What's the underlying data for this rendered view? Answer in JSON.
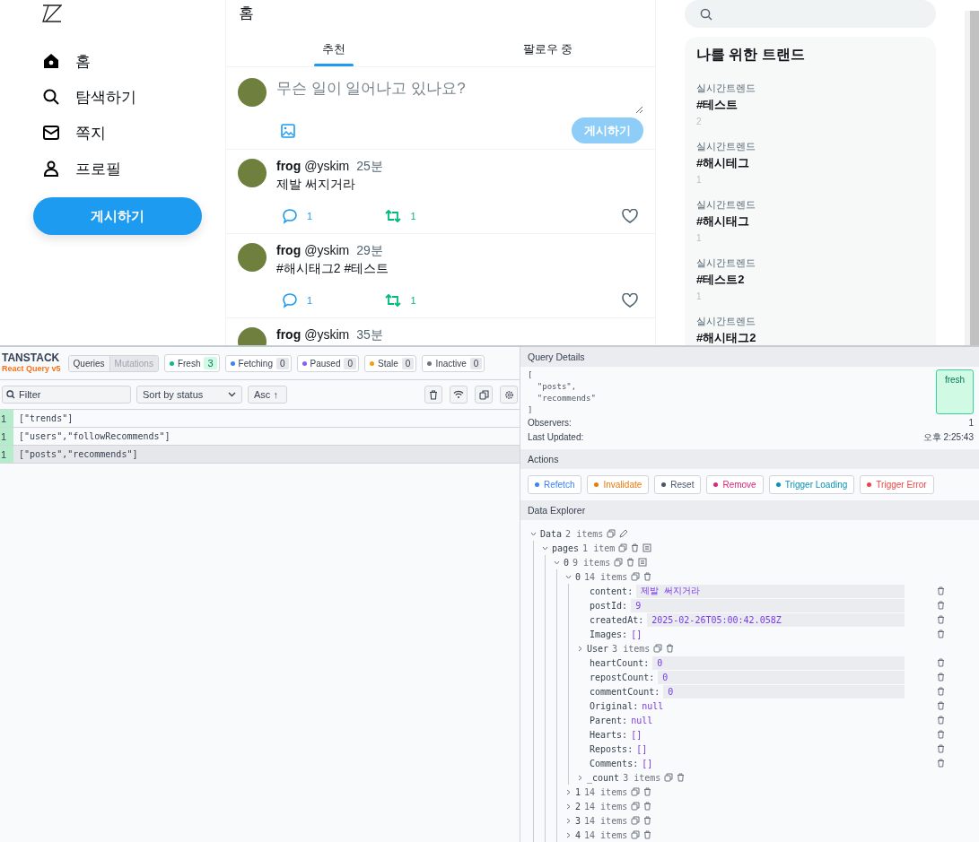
{
  "sidebar": {
    "nav": [
      {
        "label": "홈"
      },
      {
        "label": "탐색하기"
      },
      {
        "label": "쪽지"
      },
      {
        "label": "프로필"
      }
    ],
    "post_button": "게시하기"
  },
  "main": {
    "title": "홈",
    "tabs": [
      {
        "label": "추천",
        "selected": true
      },
      {
        "label": "팔로우 중",
        "selected": false
      }
    ],
    "compose": {
      "placeholder": "무슨 일이 일어나고 있나요?",
      "submit": "게시하기",
      "disabled": true
    },
    "posts": [
      {
        "author": "frog",
        "handle": "@yskim",
        "time": "25분",
        "content": "제발 써지거라",
        "comments": "1",
        "reposts": "1"
      },
      {
        "author": "frog",
        "handle": "@yskim",
        "time": "29분",
        "content": "#해시태그2 #테스트",
        "comments": "1",
        "reposts": "1"
      },
      {
        "author": "frog",
        "handle": "@yskim",
        "time": "35분"
      }
    ]
  },
  "trends": {
    "title": "나를 위한 트랜드",
    "items": [
      {
        "category": "실시간트렌드",
        "tag": "#테스트",
        "count": "2"
      },
      {
        "category": "실시간트렌드",
        "tag": "#해시테그",
        "count": "1"
      },
      {
        "category": "실시간트렌드",
        "tag": "#해시태그",
        "count": "1"
      },
      {
        "category": "실시간트렌드",
        "tag": "#테스트2",
        "count": "1"
      },
      {
        "category": "실시간트렌드",
        "tag": "#해시태그2"
      }
    ]
  },
  "devtools": {
    "brand": {
      "name": "TANSTACK",
      "product": "React Query v5"
    },
    "view_tabs": [
      {
        "label": "Queries",
        "selected": true
      },
      {
        "label": "Mutations",
        "selected": false
      }
    ],
    "statuses": [
      {
        "label": "Fresh",
        "count": "3",
        "color": "#10b981",
        "active": true
      },
      {
        "label": "Fetching",
        "count": "0",
        "color": "#3b82f6",
        "active": false
      },
      {
        "label": "Paused",
        "count": "0",
        "color": "#8b5cf6",
        "active": false
      },
      {
        "label": "Stale",
        "count": "0",
        "color": "#f59e0b",
        "active": false
      },
      {
        "label": "Inactive",
        "count": "0",
        "color": "#6b7280",
        "active": false
      }
    ],
    "filter": {
      "placeholder": "Filter"
    },
    "sort": {
      "value": "Sort by status"
    },
    "order": {
      "value": "Asc ↑"
    },
    "queries": [
      {
        "observers": "1",
        "key": "[\"trends\"]",
        "selected": false
      },
      {
        "observers": "1",
        "key": "[\"users\",\"followRecommends\"]",
        "selected": false
      },
      {
        "observers": "1",
        "key": "[\"posts\",\"recommends\"]",
        "selected": true
      }
    ],
    "details": {
      "title": "Query Details",
      "key": "[\n  \"posts\",\n  \"recommends\"\n]",
      "status": "fresh",
      "observers_label": "Observers:",
      "observers": "1",
      "updated_label": "Last Updated:",
      "updated": "오후 2:25:43"
    },
    "actions": {
      "title": "Actions",
      "buttons": [
        {
          "label": "Refetch",
          "color": "#3b82f6"
        },
        {
          "label": "Invalidate",
          "color": "#ea7a0c"
        },
        {
          "label": "Reset",
          "color": "#475569"
        },
        {
          "label": "Remove",
          "color": "#db2777"
        },
        {
          "label": "Trigger Loading",
          "color": "#0891b2"
        },
        {
          "label": "Trigger Error",
          "color": "#ef4444"
        }
      ]
    },
    "explorer": {
      "title": "Data Explorer",
      "tree": [
        {
          "key": "Data",
          "summary": "2 items",
          "kind": "root",
          "expanded": true,
          "children": [
            {
              "key": "pages",
              "summary": "1 item",
              "kind": "array",
              "expanded": true,
              "children": [
                {
                  "key": "0",
                  "summary": "9 items",
                  "kind": "array",
                  "expanded": true,
                  "children": [
                    {
                      "key": "0",
                      "summary": "14 items",
                      "kind": "object",
                      "expanded": true,
                      "children": [
                        {
                          "key": "content:",
                          "value": "제발 써지거라",
                          "kind": "field"
                        },
                        {
                          "key": "postId:",
                          "value": "9",
                          "kind": "field"
                        },
                        {
                          "key": "createdAt:",
                          "value": "2025-02-26T05:00:42.058Z",
                          "kind": "field"
                        },
                        {
                          "key": "Images:",
                          "value": "[]",
                          "kind": "plain"
                        },
                        {
                          "key": "User",
                          "summary": "3 items",
                          "kind": "object",
                          "expanded": false
                        },
                        {
                          "key": "heartCount:",
                          "value": "0",
                          "kind": "field"
                        },
                        {
                          "key": "repostCount:",
                          "value": "0",
                          "kind": "field"
                        },
                        {
                          "key": "commentCount:",
                          "value": "0",
                          "kind": "field"
                        },
                        {
                          "key": "Original:",
                          "value": "null",
                          "kind": "plain"
                        },
                        {
                          "key": "Parent:",
                          "value": "null",
                          "kind": "plain"
                        },
                        {
                          "key": "Hearts:",
                          "value": "[]",
                          "kind": "plain"
                        },
                        {
                          "key": "Reposts:",
                          "value": "[]",
                          "kind": "plain"
                        },
                        {
                          "key": "Comments:",
                          "value": "[]",
                          "kind": "plain"
                        },
                        {
                          "key": "_count",
                          "summary": "3 items",
                          "kind": "object",
                          "expanded": false
                        }
                      ]
                    },
                    {
                      "key": "1",
                      "summary": "14 items",
                      "kind": "object",
                      "expanded": false
                    },
                    {
                      "key": "2",
                      "summary": "14 items",
                      "kind": "object",
                      "expanded": false
                    },
                    {
                      "key": "3",
                      "summary": "14 items",
                      "kind": "object",
                      "expanded": false
                    },
                    {
                      "key": "4",
                      "summary": "14 items",
                      "kind": "object",
                      "expanded": false
                    }
                  ]
                }
              ]
            }
          ]
        }
      ]
    }
  }
}
